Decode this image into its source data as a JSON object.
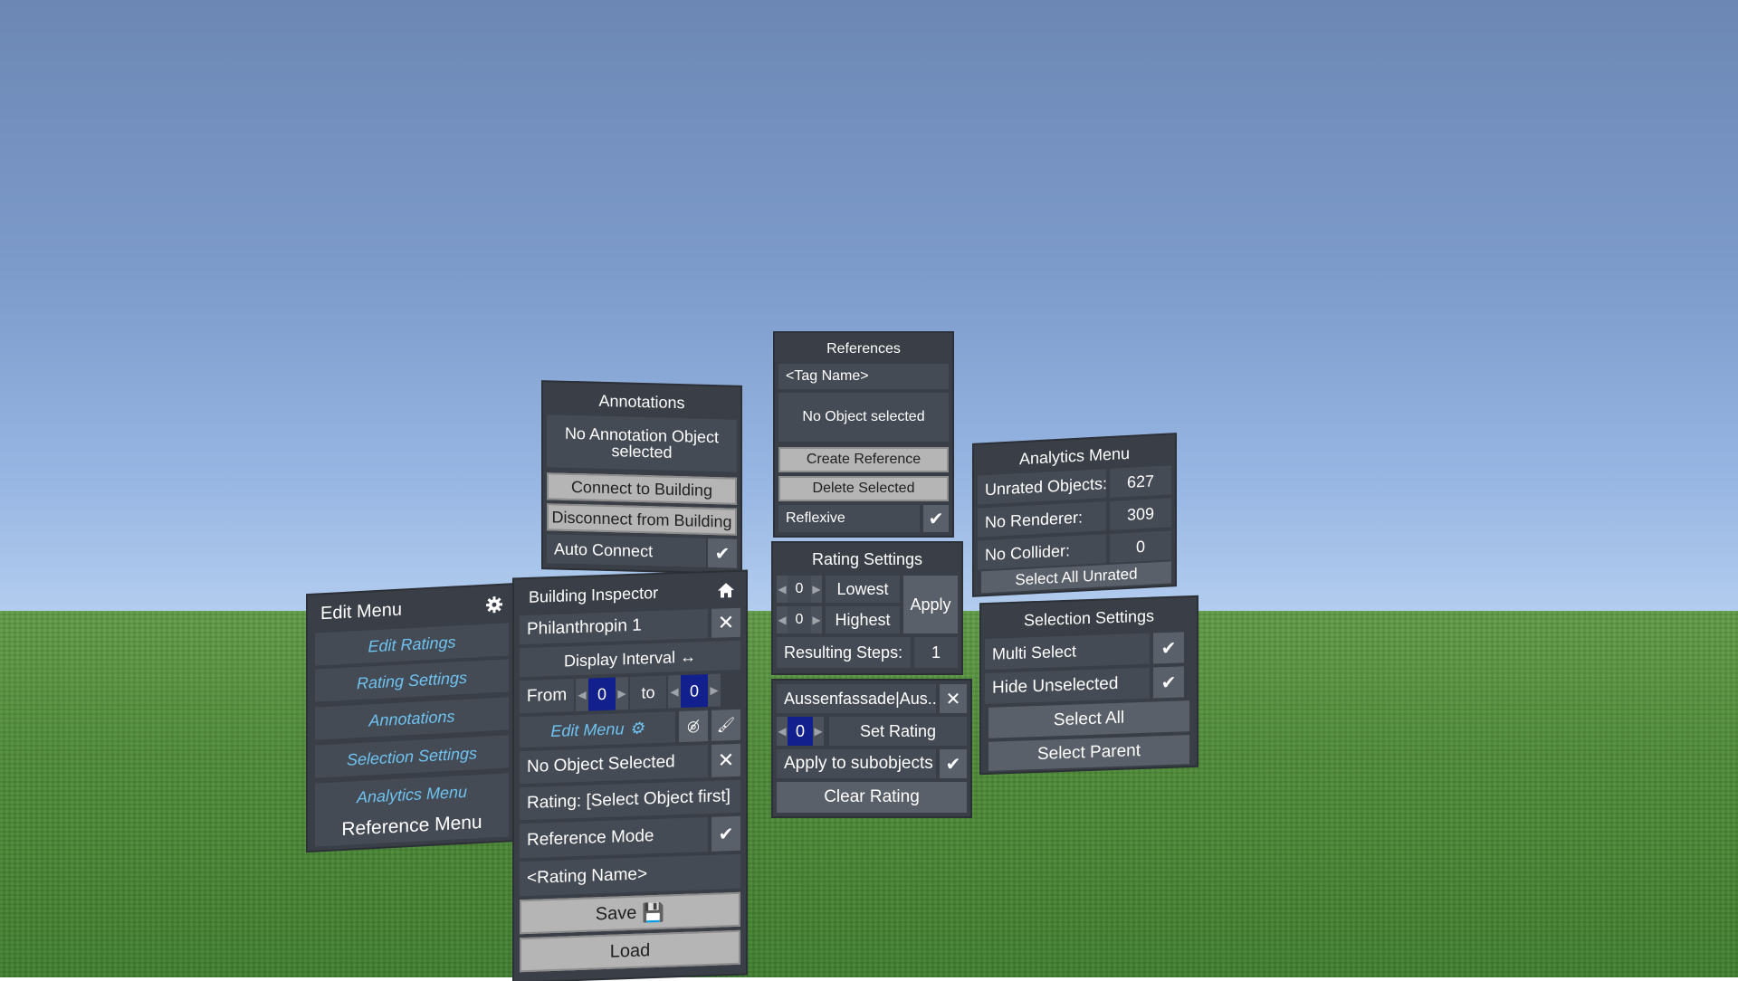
{
  "edit_menu": {
    "title": "Edit Menu",
    "items": [
      "Edit Ratings",
      "Rating Settings",
      "Annotations",
      "Selection Settings",
      "Analytics Menu",
      "Reference Menu"
    ]
  },
  "annotations": {
    "title": "Annotations",
    "status": "No Annotation Object selected",
    "connect": "Connect to Building",
    "disconnect": "Disconnect from Building",
    "auto_connect": "Auto Connect"
  },
  "building_inspector": {
    "title": "Building Inspector",
    "building_name": "Philanthropin 1",
    "display_interval": "Display Interval ↔",
    "from_label": "From",
    "from_value": "0",
    "to_label": "to",
    "to_value": "0",
    "edit_menu_button": "Edit Menu",
    "object_status": "No Object Selected",
    "rating_status": "Rating: [Select Object first]",
    "reference_mode": "Reference Mode",
    "rating_name_placeholder": "<Rating Name>",
    "save": "Save",
    "load": "Load"
  },
  "references": {
    "title": "References",
    "tag_placeholder": "<Tag Name>",
    "status": "No Object selected",
    "create": "Create Reference",
    "delete": "Delete Selected",
    "reflexive": "Reflexive"
  },
  "rating_settings": {
    "title": "Rating Settings",
    "lowest_value": "0",
    "lowest_label": "Lowest",
    "highest_value": "0",
    "highest_label": "Highest",
    "apply": "Apply",
    "steps_label": "Resulting Steps:",
    "steps_value": "1"
  },
  "rating_panel": {
    "object_name": "Aussenfassade|Aus...",
    "rating_value": "0",
    "set_rating": "Set Rating",
    "apply_subobjects": "Apply to subobjects",
    "clear_rating": "Clear Rating"
  },
  "analytics": {
    "title": "Analytics Menu",
    "rows": [
      {
        "label": "Unrated Objects:",
        "value": "627"
      },
      {
        "label": "No Renderer:",
        "value": "309"
      },
      {
        "label": "No Collider:",
        "value": "0"
      }
    ],
    "select_unrated": "Select All Unrated"
  },
  "selection_settings": {
    "title": "Selection Settings",
    "multi_select": "Multi Select",
    "hide_unselected": "Hide Unselected",
    "select_all": "Select All",
    "select_parent": "Select Parent"
  },
  "icons": [
    "gear-icon",
    "home-icon",
    "close-icon",
    "check-icon",
    "hide-icon",
    "brush-icon",
    "save-icon"
  ]
}
